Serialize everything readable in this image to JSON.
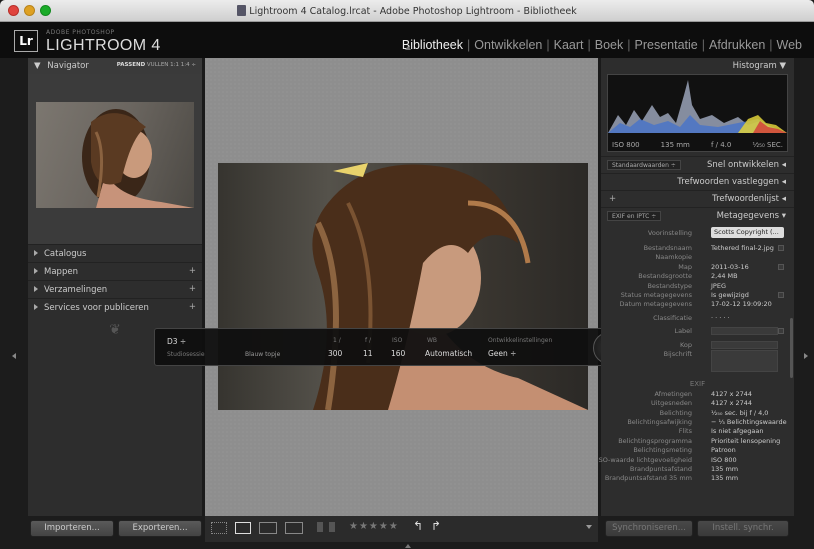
{
  "window": {
    "title": "Lightroom 4 Catalog.lrcat - Adobe Photoshop Lightroom - Bibliotheek"
  },
  "brand": {
    "small": "ADOBE PHOTOSHOP",
    "name": "LIGHTROOM 4",
    "badge": "Lr"
  },
  "modules": [
    "Bibliotheek",
    "Ontwikkelen",
    "Kaart",
    "Boek",
    "Presentatie",
    "Afdrukken",
    "Web"
  ],
  "navigator": {
    "label": "Navigator",
    "options": [
      "PASSEND",
      "VULLEN",
      "1:1",
      "1:4 ÷"
    ]
  },
  "left_sections": [
    "Catalogus",
    "Mappen",
    "Verzamelingen",
    "Services voor publiceren"
  ],
  "right": {
    "histogram_label": "Histogram",
    "histogram_info": {
      "iso": "ISO 800",
      "focal": "135 mm",
      "aperture": "f / 4.0",
      "shutter": "¹⁄₂₅₀ SEC."
    },
    "quick_develop": {
      "preset": "Standaardwaarden ÷",
      "label": "Snel ontwikkelen"
    },
    "keywording": "Trefwoorden vastleggen",
    "keyword_list": "Trefwoordenlijst",
    "metadata": {
      "view": "EXIF en IPTC ÷",
      "label": "Metagegevens"
    },
    "preset_label": "Voorinstelling",
    "preset_value": "Scotts Copyright (...",
    "file_rows": [
      {
        "k": "Bestandsnaam",
        "v": "Tethered final-2.jpg"
      },
      {
        "k": "Naamkopie",
        "v": ""
      },
      {
        "k": "Map",
        "v": "2011-03-16"
      },
      {
        "k": "Bestandsgrootte",
        "v": "2,44 MB"
      },
      {
        "k": "Bestandstype",
        "v": "JPEG"
      },
      {
        "k": "Status metagegevens",
        "v": "Is gewijzigd"
      },
      {
        "k": "Datum metagegevens",
        "v": "17-02-12 19:09:20"
      }
    ],
    "classification_label": "Classificatie",
    "rating_dots": "·  ·  ·  ·  ·",
    "label_label": "Label",
    "kop_label": "Kop",
    "caption_label": "Bijschrift",
    "exif_label": "EXIF",
    "exif_rows": [
      {
        "k": "Afmetingen",
        "v": "4127 x 2744"
      },
      {
        "k": "Uitgesneden",
        "v": "4127 x 2744"
      },
      {
        "k": "Belichting",
        "v": "¹⁄₂₅₀ sec. bij f / 4,0"
      },
      {
        "k": "Belichtingsafwijking",
        "v": "− ¹⁄₃ Belichtingswaarde"
      },
      {
        "k": "Flits",
        "v": "Is niet afgegaan"
      },
      {
        "k": "Belichtingsprogramma",
        "v": "Prioriteit lensopening"
      },
      {
        "k": "Belichtingsmeting",
        "v": "Patroon"
      },
      {
        "k": "ISO-waarde lichtgevoeligheid",
        "v": "ISO 800"
      },
      {
        "k": "Brandpuntsafstand",
        "v": "135 mm"
      },
      {
        "k": "Brandpuntsafstand 35 mm",
        "v": "135 mm"
      }
    ]
  },
  "hud": {
    "camera": "D3 ÷",
    "session_label": "Studiosessie",
    "session_value": "Blauw topje",
    "headers": [
      "1 /",
      "f /",
      "ISO",
      "WB",
      "Ontwikkelinstellingen"
    ],
    "values": [
      "300",
      "11",
      "160",
      "Automatisch",
      "Geen ÷"
    ]
  },
  "bottom": {
    "import": "Importeren...",
    "export": "Exporteren...",
    "sync_meta": "Synchroniseren...",
    "auto_sync": "Instell. synchr."
  },
  "toolbar": {
    "stars": "★★★★★",
    "rotate_left": "↰",
    "rotate_right": "↱"
  }
}
